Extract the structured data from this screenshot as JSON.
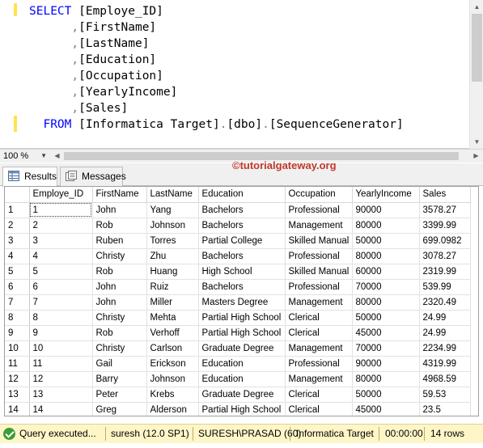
{
  "editor": {
    "lines": [
      {
        "indent": "",
        "keyword": "SELECT",
        "text": " [Employe_ID]"
      },
      {
        "indent": "      ",
        "comma": ",",
        "text": "[FirstName]"
      },
      {
        "indent": "      ",
        "comma": ",",
        "text": "[LastName]"
      },
      {
        "indent": "      ",
        "comma": ",",
        "text": "[Education]"
      },
      {
        "indent": "      ",
        "comma": ",",
        "text": "[Occupation]"
      },
      {
        "indent": "      ",
        "comma": ",",
        "text": "[YearlyIncome]"
      },
      {
        "indent": "      ",
        "comma": ",",
        "text": "[Sales]"
      },
      {
        "indent": "  ",
        "keyword": "FROM",
        "text": " [Informatica Target]",
        "dot1": ".",
        "schema": "[dbo]",
        "dot2": ".",
        "table": "[SequenceGenerator]"
      }
    ]
  },
  "zoom": {
    "value": "100 %"
  },
  "tabs": {
    "results": "Results",
    "messages": "Messages"
  },
  "watermark": "©tutorialgateway.org",
  "grid": {
    "columns": [
      "Employe_ID",
      "FirstName",
      "LastName",
      "Education",
      "Occupation",
      "YearlyIncome",
      "Sales"
    ],
    "rows": [
      [
        "1",
        "1",
        "John",
        "Yang",
        "Bachelors",
        "Professional",
        "90000",
        "3578.27"
      ],
      [
        "2",
        "2",
        "Rob",
        "Johnson",
        "Bachelors",
        "Management",
        "80000",
        "3399.99"
      ],
      [
        "3",
        "3",
        "Ruben",
        "Torres",
        "Partial College",
        "Skilled Manual",
        "50000",
        "699.0982"
      ],
      [
        "4",
        "4",
        "Christy",
        "Zhu",
        "Bachelors",
        "Professional",
        "80000",
        "3078.27"
      ],
      [
        "5",
        "5",
        "Rob",
        "Huang",
        "High School",
        "Skilled Manual",
        "60000",
        "2319.99"
      ],
      [
        "6",
        "6",
        "John",
        "Ruiz",
        "Bachelors",
        "Professional",
        "70000",
        "539.99"
      ],
      [
        "7",
        "7",
        "John",
        "Miller",
        "Masters Degree",
        "Management",
        "80000",
        "2320.49"
      ],
      [
        "8",
        "8",
        "Christy",
        "Mehta",
        "Partial High School",
        "Clerical",
        "50000",
        "24.99"
      ],
      [
        "9",
        "9",
        "Rob",
        "Verhoff",
        "Partial High School",
        "Clerical",
        "45000",
        "24.99"
      ],
      [
        "10",
        "10",
        "Christy",
        "Carlson",
        "Graduate Degree",
        "Management",
        "70000",
        "2234.99"
      ],
      [
        "11",
        "11",
        "Gail",
        "Erickson",
        "Education",
        "Professional",
        "90000",
        "4319.99"
      ],
      [
        "12",
        "12",
        "Barry",
        "Johnson",
        "Education",
        "Management",
        "80000",
        "4968.59"
      ],
      [
        "13",
        "13",
        "Peter",
        "Krebs",
        "Graduate Degree",
        "Clerical",
        "50000",
        "59.53"
      ],
      [
        "14",
        "14",
        "Greg",
        "Alderson",
        "Partial High School",
        "Clerical",
        "45000",
        "23.5"
      ]
    ]
  },
  "status": {
    "message": "Query  executed...",
    "server": "suresh (12.0 SP1)",
    "user": "SURESH\\PRASAD (60)",
    "database": "Informatica Target",
    "elapsed": "00:00:00",
    "rows": "14 rows"
  },
  "colors": {
    "keyword": "#0000ff",
    "punct": "#808080",
    "status_bg": "#fff6c8",
    "watermark": "#c0392b"
  }
}
